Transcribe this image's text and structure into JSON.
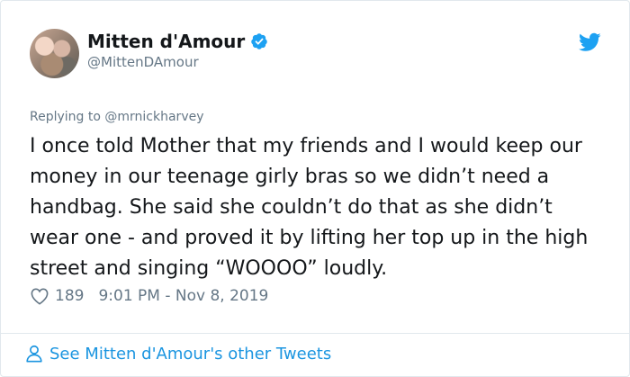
{
  "author": {
    "name": "Mitten d'Amour",
    "handle": "@MittenDAmour"
  },
  "reply": {
    "prefix": "Replying to ",
    "to": "@mrnickharvey"
  },
  "tweet": {
    "text": "I once told Mother that my friends and I would keep our money in our teenage girly bras so we didn’t need a handbag. She said she couldn’t do that as she didn’t wear one - and proved it by lifting her top up in the high street and singing “WOOOO” loudly.",
    "likes": "189",
    "timestamp": "9:01 PM - Nov 8, 2019"
  },
  "footer": {
    "link_label": "See Mitten d'Amour's other Tweets"
  },
  "icons": {
    "verified": "verified-badge-icon",
    "twitter": "twitter-bird-icon",
    "like": "heart-icon",
    "profile": "person-icon"
  },
  "colors": {
    "accent": "#1da1f2",
    "link": "#1b95e0",
    "muted": "#657786",
    "text": "#14171a"
  }
}
